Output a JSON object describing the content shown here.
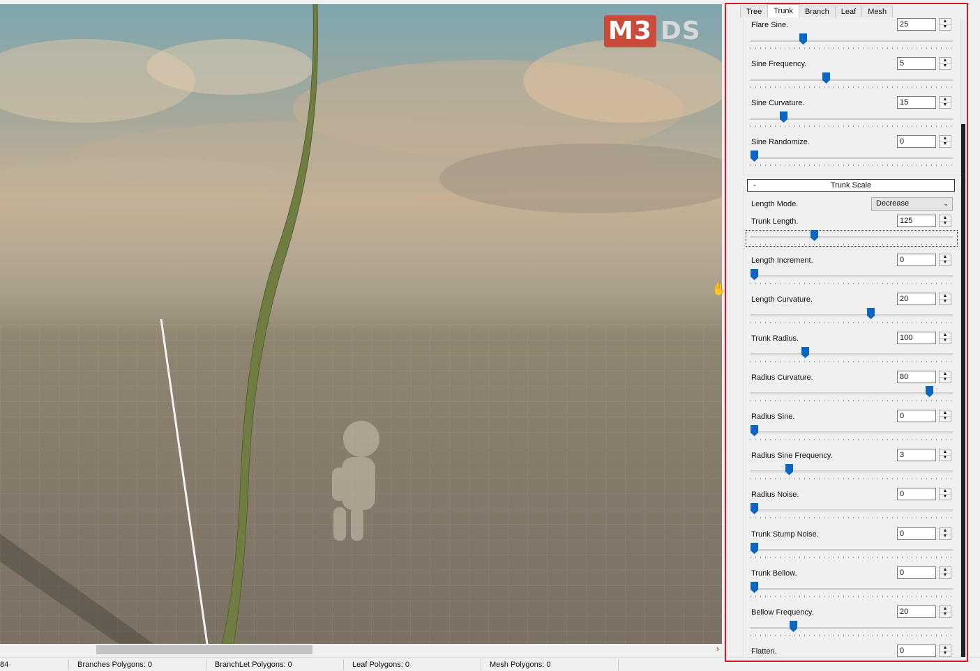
{
  "logo": {
    "m3": "M3",
    "ds": "DS"
  },
  "tabs": [
    {
      "label": "Tree",
      "active": false
    },
    {
      "label": "Trunk",
      "active": true
    },
    {
      "label": "Branch",
      "active": false
    },
    {
      "label": "Leaf",
      "active": false
    },
    {
      "label": "Mesh",
      "active": false
    }
  ],
  "section": {
    "minus": "-",
    "title": "Trunk Scale"
  },
  "length_mode": {
    "label": "Length Mode.",
    "value": "Decrease"
  },
  "params": [
    {
      "label": "Flare Sine.",
      "value": "25",
      "level": 0.25
    },
    {
      "label": "Sine Frequency.",
      "value": "5",
      "level": 0.37
    },
    {
      "label": "Sine Curvature.",
      "value": "15",
      "level": 0.15
    },
    {
      "label": "Sine Randomize.",
      "value": "0",
      "level": 0.0
    },
    {
      "label": "Trunk Length.",
      "value": "125",
      "level": 0.31
    },
    {
      "label": "Length Increment.",
      "value": "0",
      "level": 0.0
    },
    {
      "label": "Length Curvature.",
      "value": "20",
      "level": 0.6
    },
    {
      "label": "Trunk Radius.",
      "value": "100",
      "level": 0.26
    },
    {
      "label": "Radius Curvature.",
      "value": "80",
      "level": 0.9
    },
    {
      "label": "Radius Sine.",
      "value": "0",
      "level": 0.0
    },
    {
      "label": "Radius Sine Frequency.",
      "value": "3",
      "level": 0.18
    },
    {
      "label": "Radius Noise.",
      "value": "0",
      "level": 0.0
    },
    {
      "label": "Trunk Stump Noise.",
      "value": "0",
      "level": 0.0
    },
    {
      "label": "Trunk Bellow.",
      "value": "0",
      "level": 0.0
    },
    {
      "label": "Bellow Frequency.",
      "value": "20",
      "level": 0.2
    },
    {
      "label": "Flatten.",
      "value": "0",
      "level": 0.0
    }
  ],
  "status": [
    "84",
    "Branches Polygons: 0",
    "BranchLet Polygons: 0",
    "Leaf Polygons:  0",
    "Mesh Polygons:  0"
  ],
  "colors": {
    "accent": "#0a66c2",
    "highlight_border": "#e0141e",
    "logo_red": "#c94c3a"
  }
}
